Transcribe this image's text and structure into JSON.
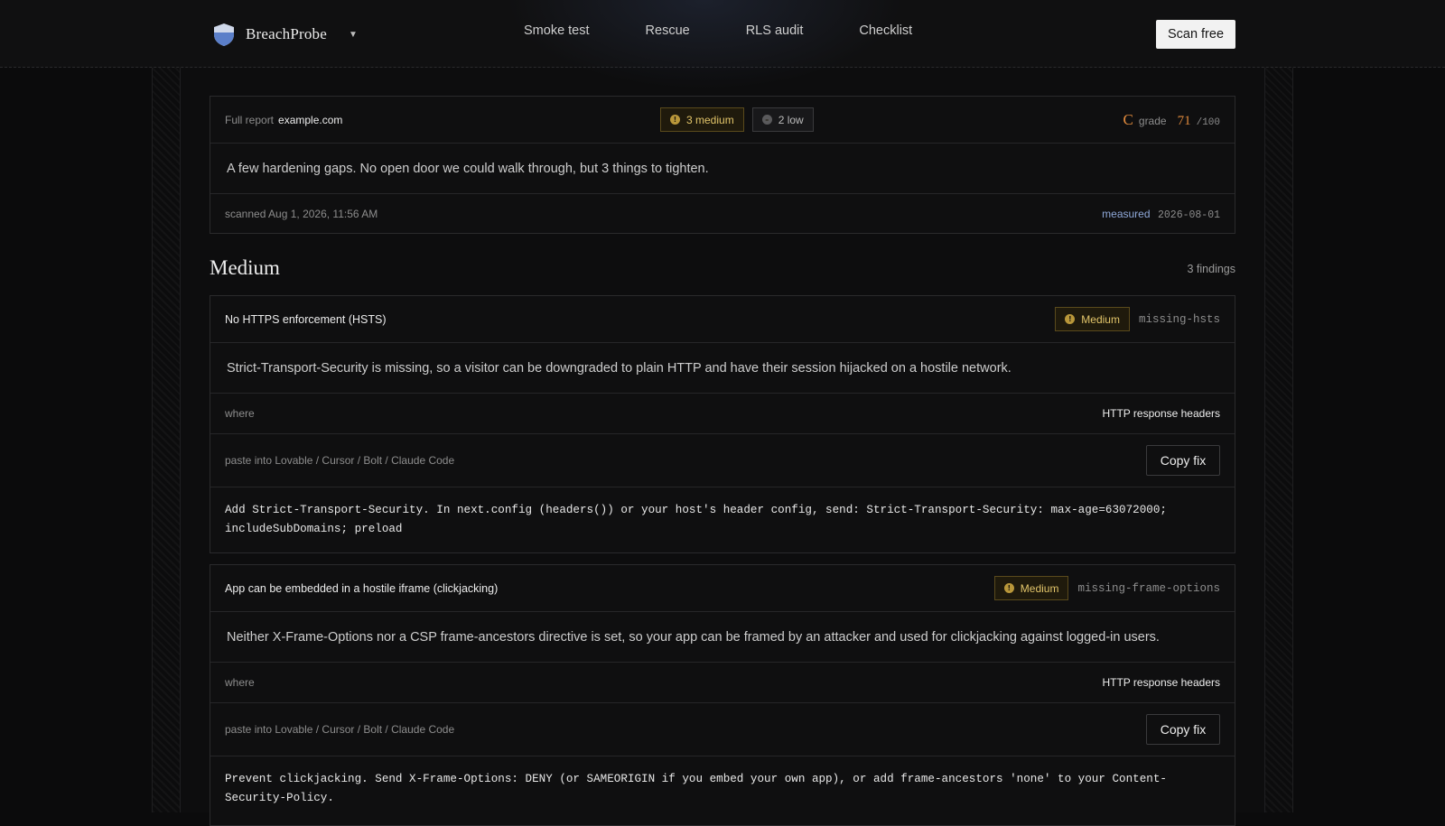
{
  "header": {
    "brand": "BreachProbe",
    "nav": [
      "Smoke test",
      "Rescue",
      "RLS audit",
      "Checklist"
    ],
    "cta": "Scan free"
  },
  "report": {
    "label": "Full report",
    "domain": "example.com",
    "medium_count": "3 medium",
    "low_count": "2 low",
    "grade_letter": "C",
    "grade_label": "grade",
    "score": "71",
    "score_max": "/100",
    "summary": "A few hardening gaps. No open door we could walk through, but 3 things to tighten.",
    "scanned": "scanned Aug 1, 2026, 11:56 AM",
    "measured_label": "measured",
    "measured_date": "2026-08-01"
  },
  "section": {
    "title": "Medium",
    "count": "3 findings"
  },
  "findings": [
    {
      "title": "No HTTPS enforcement (HSTS)",
      "severity": "Medium",
      "id": "missing-hsts",
      "description": "Strict-Transport-Security is missing, so a visitor can be downgraded to plain HTTP and have their session hijacked on a hostile network.",
      "where_label": "where",
      "where_value": "HTTP response headers",
      "paste_label": "paste into Lovable / Cursor / Bolt / Claude Code",
      "copy_label": "Copy fix",
      "fix": "Add Strict-Transport-Security. In next.config (headers()) or your host's header config, send: Strict-Transport-Security: max-age=63072000; includeSubDomains; preload"
    },
    {
      "title": "App can be embedded in a hostile iframe (clickjacking)",
      "severity": "Medium",
      "id": "missing-frame-options",
      "description": "Neither X-Frame-Options nor a CSP frame-ancestors directive is set, so your app can be framed by an attacker and used for clickjacking against logged-in users.",
      "where_label": "where",
      "where_value": "HTTP response headers",
      "paste_label": "paste into Lovable / Cursor / Bolt / Claude Code",
      "copy_label": "Copy fix",
      "fix": "Prevent clickjacking. Send X-Frame-Options: DENY (or SAMEORIGIN if you embed your own app), or add frame-ancestors 'none' to your Content-Security-Policy."
    }
  ],
  "colors": {
    "grade": "#e08a3c",
    "medium_badge": "#e2c56a",
    "measured_label": "#8fa8d8"
  }
}
